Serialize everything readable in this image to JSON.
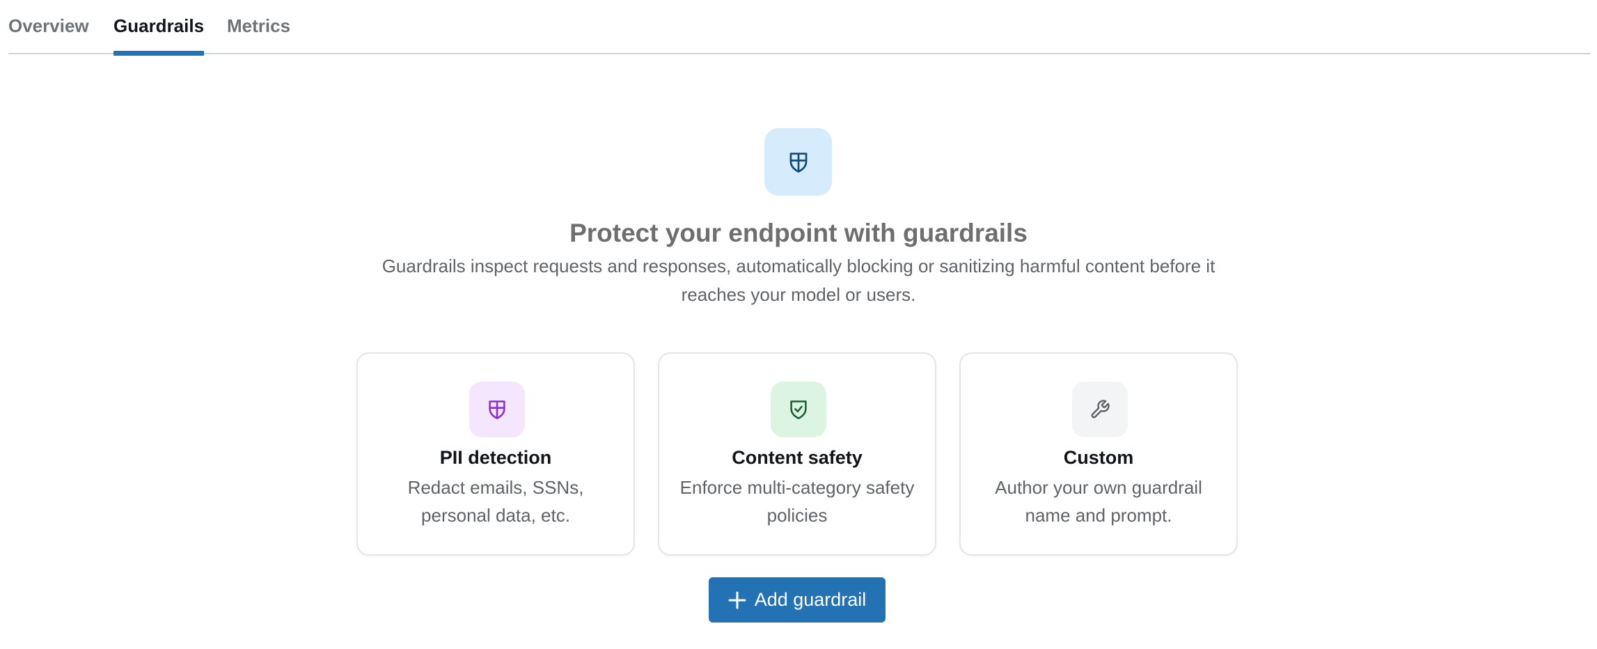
{
  "tabs": [
    {
      "label": "Overview",
      "active": false
    },
    {
      "label": "Guardrails",
      "active": true
    },
    {
      "label": "Metrics",
      "active": false
    }
  ],
  "hero": {
    "icon": "shield-icon",
    "title": "Protect your endpoint with guardrails",
    "description": "Guardrails inspect requests and responses, automatically blocking or sanitizing harmful content before it reaches your model or users."
  },
  "cards": [
    {
      "icon": "shield-icon",
      "title": "PII detection",
      "description": "Redact emails, SSNs, personal data, etc.",
      "accent": "#8c2bd9",
      "bg": "#f3e6fd"
    },
    {
      "icon": "shield-check-icon",
      "title": "Content safety",
      "description": "Enforce multi-category safety policies",
      "accent": "#1b5e34",
      "bg": "#dcf5e3"
    },
    {
      "icon": "wrench-icon",
      "title": "Custom",
      "description": "Author your own guardrail name and prompt.",
      "accent": "#5f6368",
      "bg": "#f3f4f5"
    }
  ],
  "add_button": {
    "label": "Add guardrail",
    "icon": "plus-icon"
  },
  "colors": {
    "primary": "#2272b4",
    "hero_icon_bg": "#d6ebfc",
    "hero_icon": "#0e4a7a"
  }
}
